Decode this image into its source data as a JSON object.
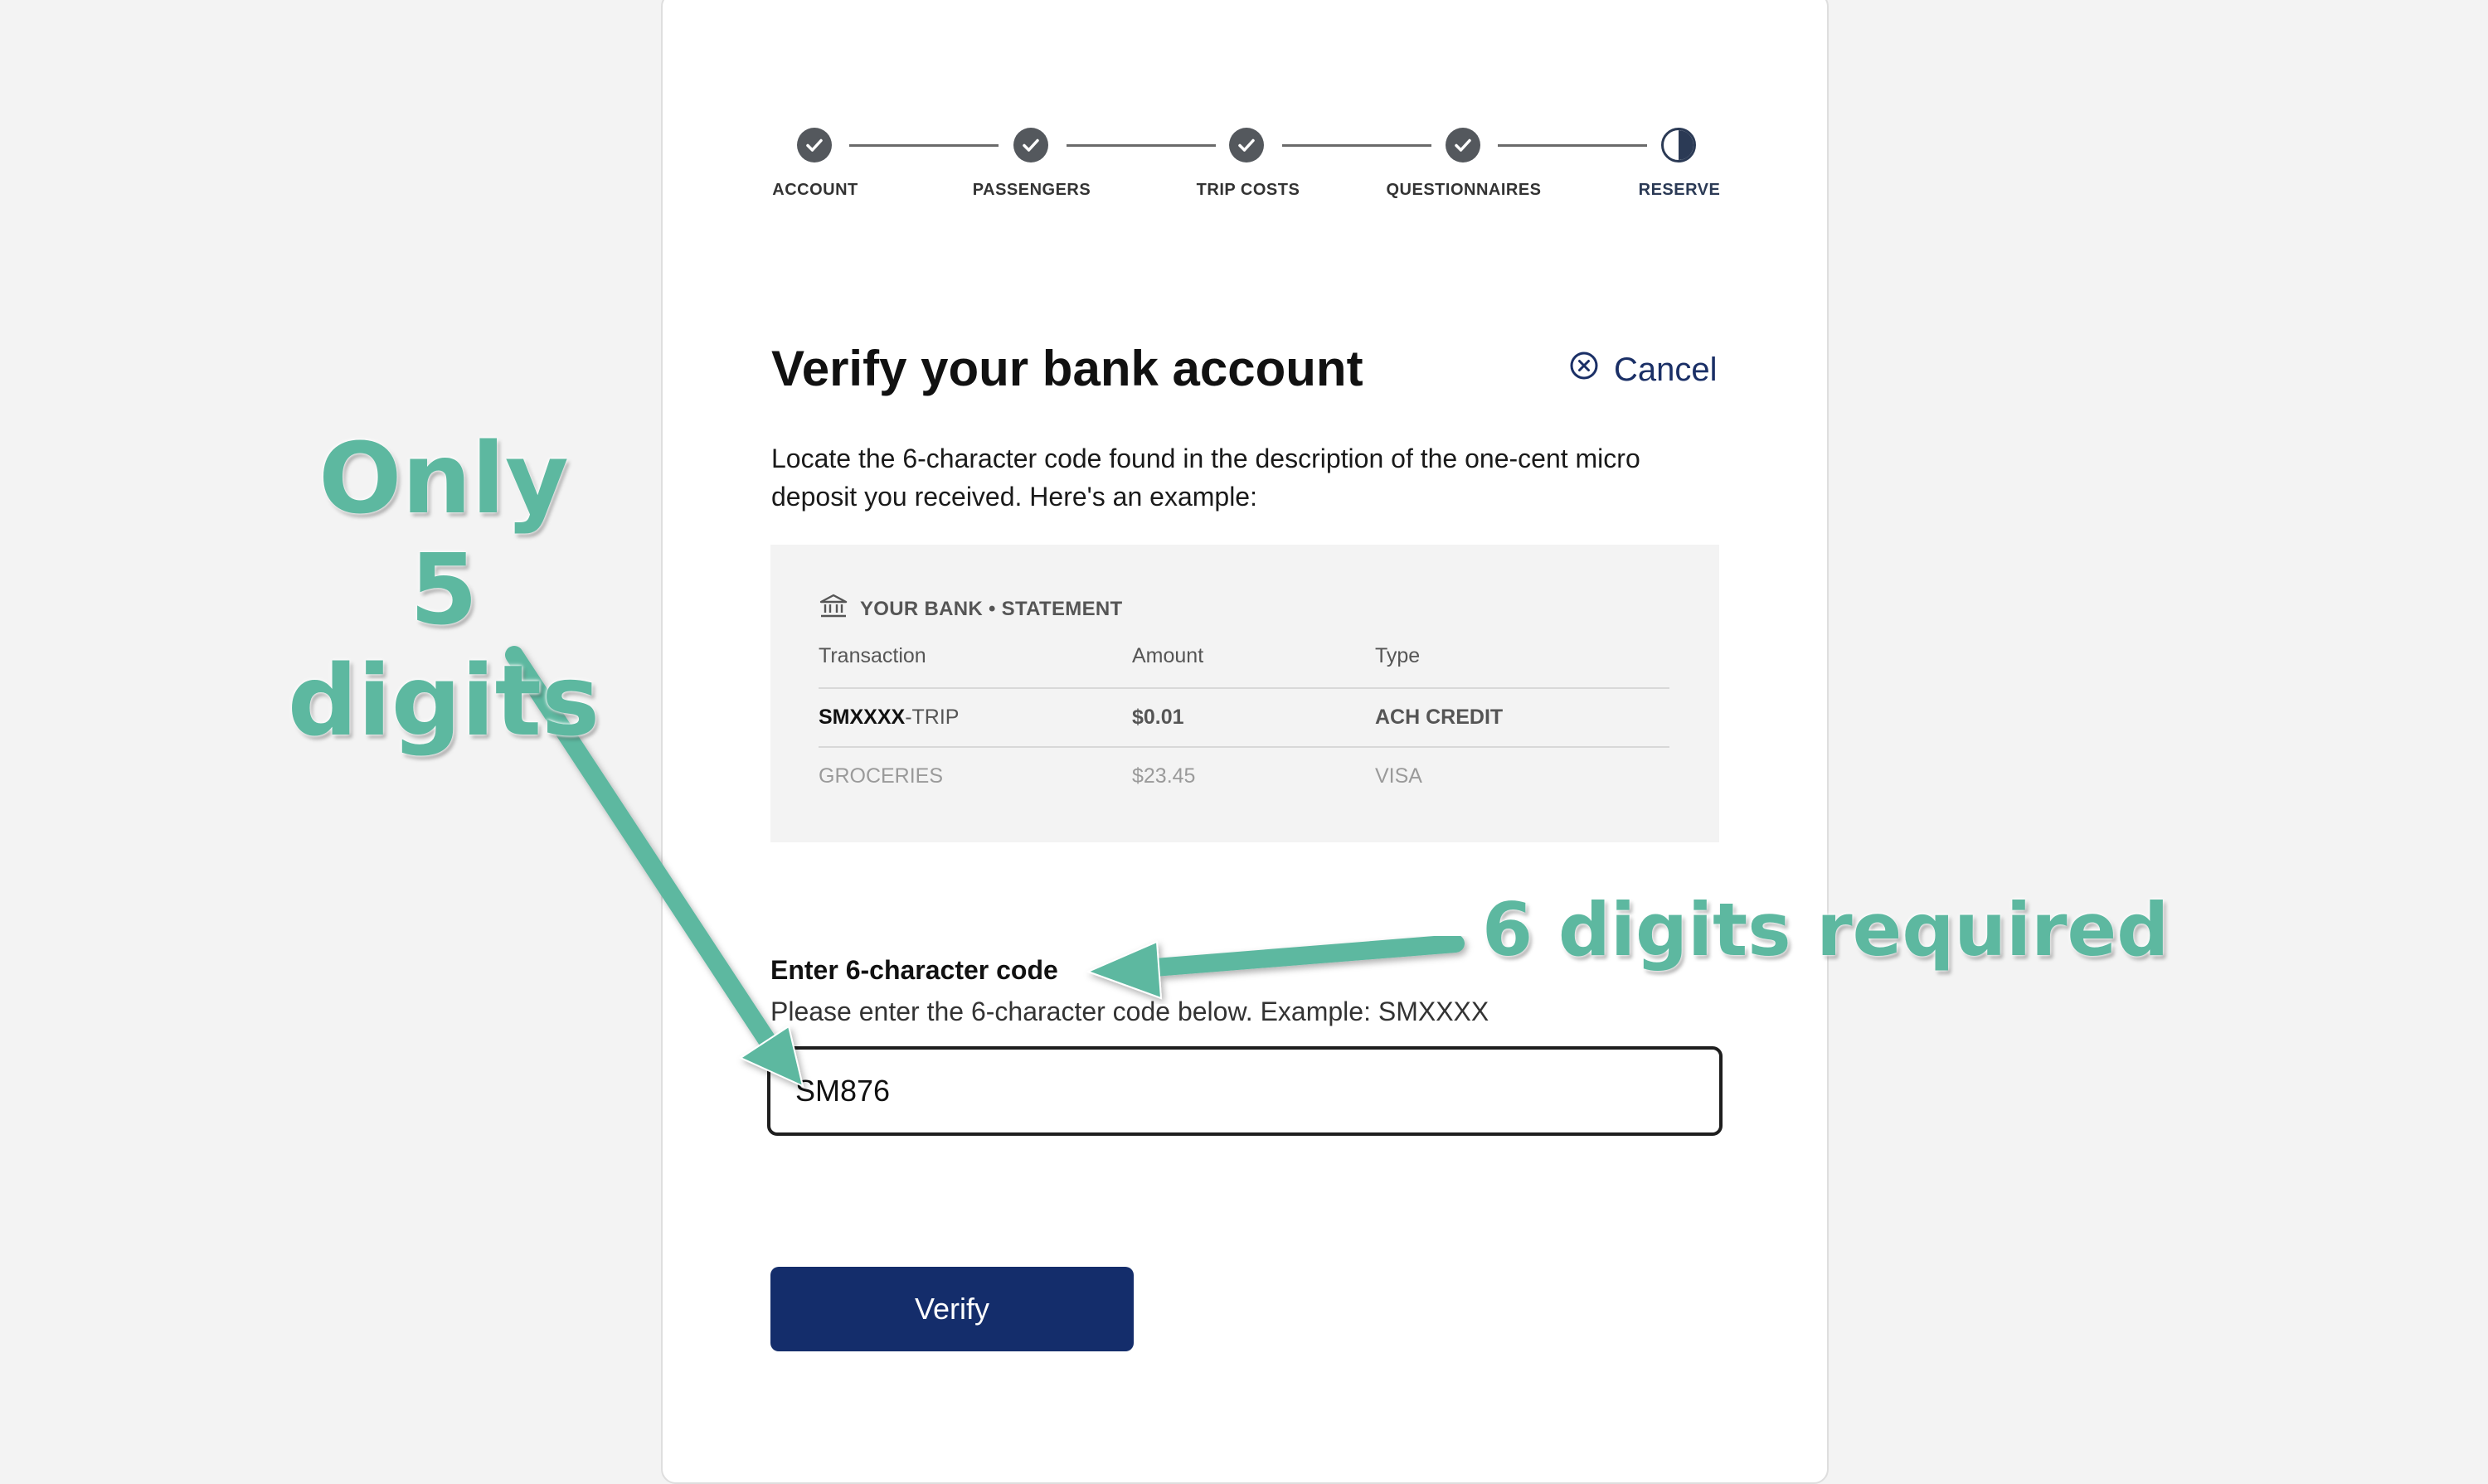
{
  "stepper": {
    "steps": [
      {
        "label": "ACCOUNT",
        "state": "complete"
      },
      {
        "label": "PASSENGERS",
        "state": "complete"
      },
      {
        "label": "TRIP COSTS",
        "state": "complete"
      },
      {
        "label": "QUESTIONNAIRES",
        "state": "complete"
      },
      {
        "label": "RESERVE",
        "state": "current"
      }
    ]
  },
  "header": {
    "title": "Verify your bank account",
    "cancel_label": "Cancel",
    "cancel_icon": "circle-x-icon"
  },
  "intro_text": "Locate the 6-character code found in the description of the one-cent micro deposit you received. Here's an example:",
  "statement": {
    "heading": "YOUR BANK • STATEMENT",
    "icon": "bank-icon",
    "columns": [
      "Transaction",
      "Amount",
      "Type"
    ],
    "rows": [
      {
        "code": "SMXXXX",
        "suffix": "-TRIP",
        "amount": "$0.01",
        "type": "ACH CREDIT"
      },
      {
        "code": "GROCERIES",
        "suffix": "",
        "amount": "$23.45",
        "type": "VISA"
      }
    ]
  },
  "code_field": {
    "label": "Enter 6-character code",
    "help": "Please enter the 6-character code below. Example: SMXXXX",
    "value": "SM876"
  },
  "verify_label": "Verify",
  "annotations": {
    "left_line1": "Only",
    "left_line2": "5 digits",
    "right": "6 digits required",
    "color": "#5db8a0"
  },
  "colors": {
    "primary": "#142d6b",
    "link": "#1a2f66",
    "step_complete": "#54585d",
    "step_current": "#2b3a55"
  }
}
